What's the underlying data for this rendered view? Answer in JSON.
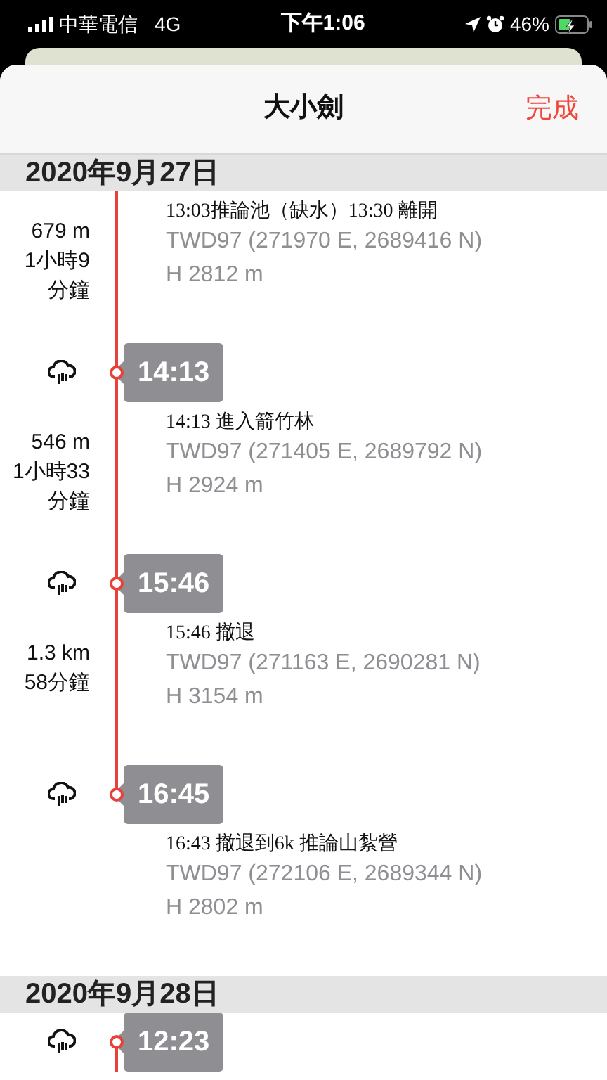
{
  "status_bar": {
    "carrier": "中華電信",
    "network": "4G",
    "time": "下午1:06",
    "battery_text": "46%",
    "battery": {
      "charging": true
    }
  },
  "header": {
    "title": "大小劍",
    "done": "完成"
  },
  "days": [
    {
      "date": "2020年9月27日",
      "entries": [
        {
          "kind": "segment",
          "connected": true,
          "stats": [
            "679 m",
            "1小時9",
            "分鐘"
          ],
          "note": "13:03推論池（缺水）13:30 離開",
          "coords": "TWD97 (271970 E, 2689416 N)",
          "elevation": "H 2812 m"
        },
        {
          "kind": "stop",
          "time": "14:13"
        },
        {
          "kind": "segment",
          "connected": true,
          "stats": [
            "546 m",
            "1小時33",
            "分鐘"
          ],
          "note": "14:13 進入箭竹林",
          "coords": "TWD97 (271405 E, 2689792 N)",
          "elevation": "H 2924 m"
        },
        {
          "kind": "stop",
          "time": "15:46"
        },
        {
          "kind": "segment",
          "connected": true,
          "stats": [
            "1.3 km",
            "58分鐘"
          ],
          "note": "15:46 撤退",
          "coords": "TWD97 (271163 E, 2690281 N)",
          "elevation": "H 3154 m"
        },
        {
          "kind": "stop",
          "time": "16:45"
        },
        {
          "kind": "segment",
          "connected": false,
          "note": "16:43 撤退到6k 推論山紮營",
          "coords": "TWD97 (272106 E, 2689344 N)",
          "elevation": "H 2802 m"
        }
      ]
    },
    {
      "date": "2020年9月28日",
      "entries": [
        {
          "kind": "stop",
          "time": "12:23"
        }
      ]
    }
  ]
}
